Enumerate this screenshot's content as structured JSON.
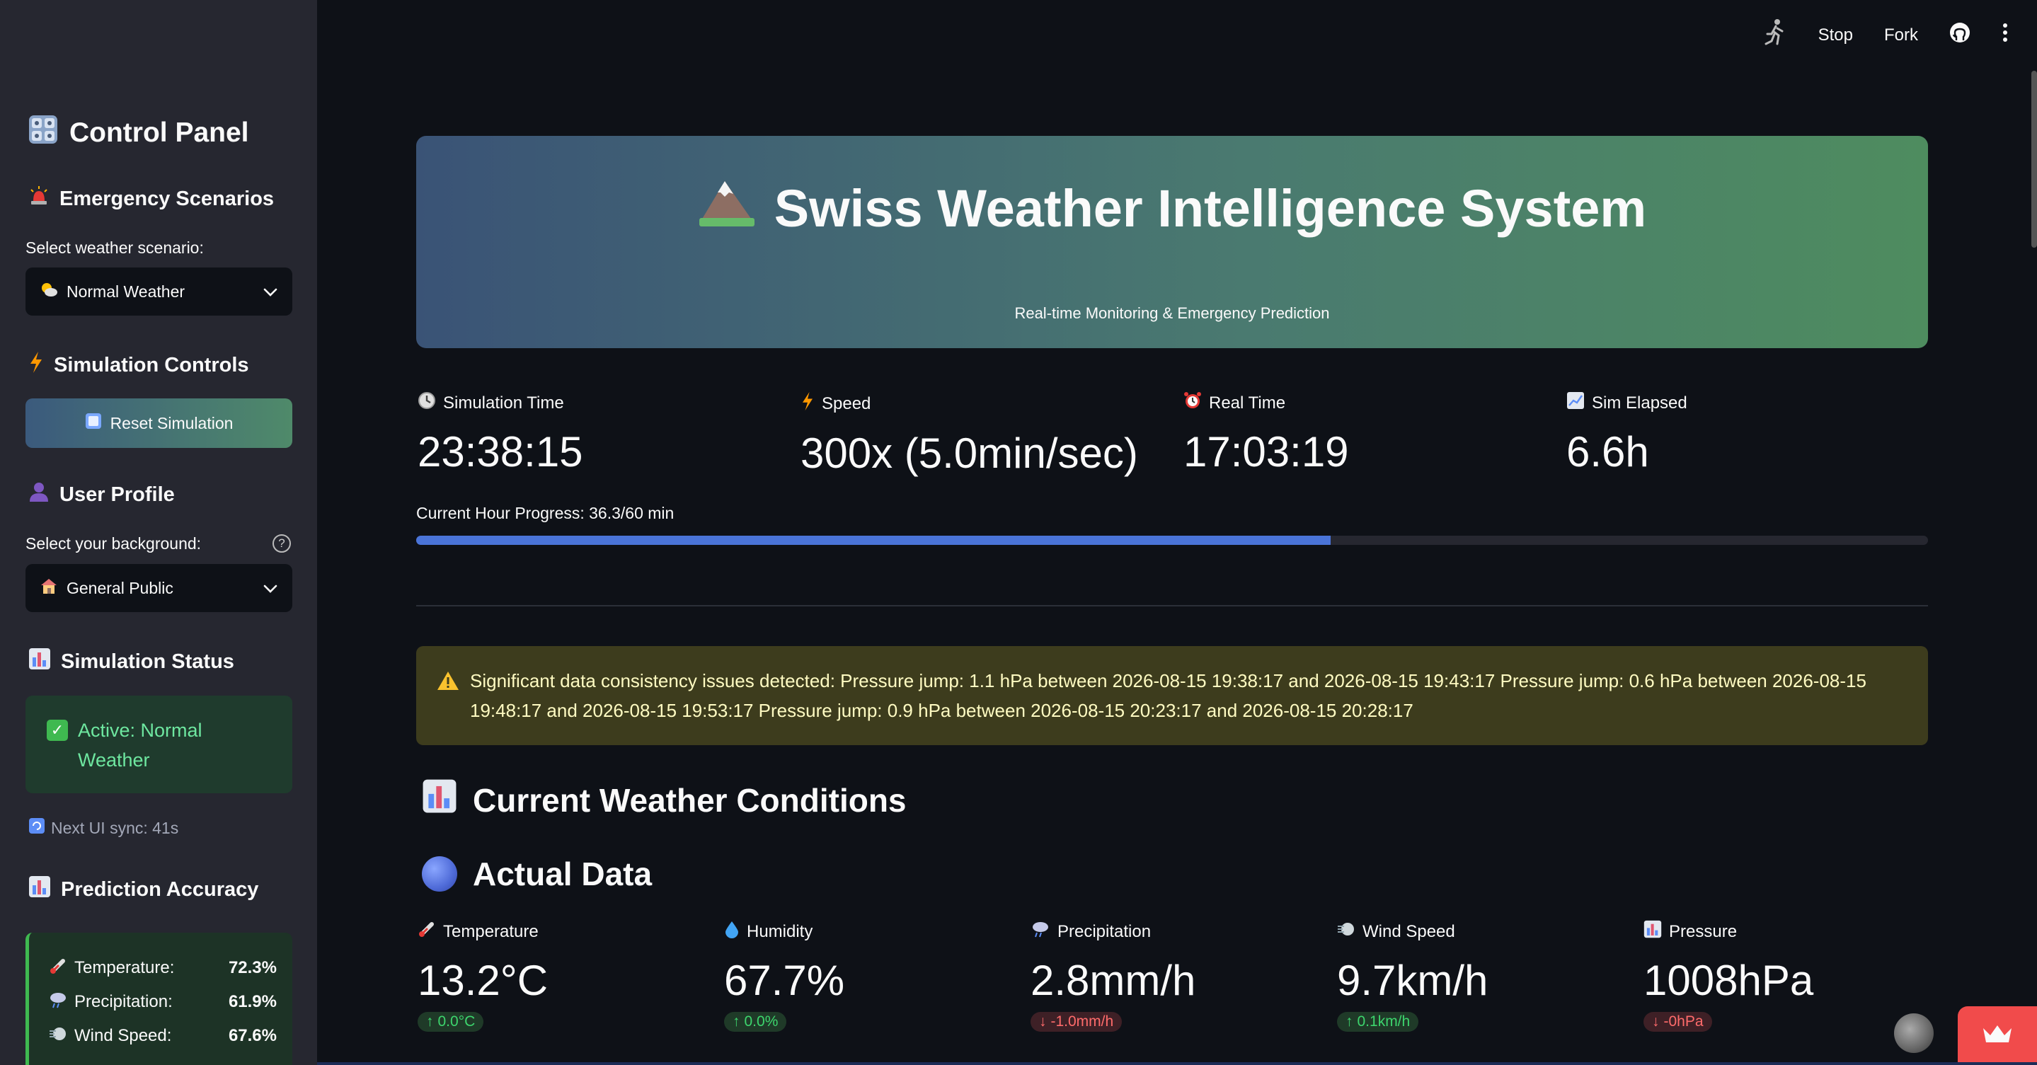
{
  "toolbar": {
    "stop_label": "Stop",
    "fork_label": "Fork"
  },
  "sidebar": {
    "title": "Control Panel",
    "emergency": {
      "heading": "Emergency Scenarios",
      "select_label": "Select weather scenario:",
      "selected": "Normal Weather"
    },
    "simulation": {
      "heading": "Simulation Controls",
      "reset_label": "Reset Simulation"
    },
    "user_profile": {
      "heading": "User Profile",
      "select_label": "Select your background:",
      "selected": "General Public"
    },
    "status": {
      "heading": "Simulation Status",
      "active_text": "Active: Normal Weather",
      "sync_text": "Next UI sync: 41s"
    },
    "accuracy": {
      "heading": "Prediction Accuracy",
      "rows": [
        {
          "name": "Temperature:",
          "value": "72.3%"
        },
        {
          "name": "Precipitation:",
          "value": "61.9%"
        },
        {
          "name": "Wind Speed:",
          "value": "67.6%"
        }
      ]
    }
  },
  "hero": {
    "title": "Swiss Weather Intelligence System",
    "subtitle": "Real-time Monitoring & Emergency Prediction"
  },
  "metrics": {
    "sim_time": {
      "label": "Simulation Time",
      "value": "23:38:15"
    },
    "speed": {
      "label": "Speed",
      "value": "300x (5.0min/sec)"
    },
    "real_time": {
      "label": "Real Time",
      "value": "17:03:19"
    },
    "sim_elapsed": {
      "label": "Sim Elapsed",
      "value": "6.6h"
    }
  },
  "progress": {
    "label": "Current Hour Progress: 36.3/60 min",
    "fraction": 0.605
  },
  "warning": {
    "text": "Significant data consistency issues detected: Pressure jump: 1.1 hPa between 2026-08-15 19:38:17 and 2026-08-15 19:43:17 Pressure jump: 0.6 hPa between 2026-08-15 19:48:17 and 2026-08-15 19:53:17 Pressure jump: 0.9 hPa between 2026-08-15 20:23:17 and 2026-08-15 20:28:17"
  },
  "conditions": {
    "heading": "Current Weather Conditions",
    "subheading": "Actual Data",
    "items": [
      {
        "label": "Temperature",
        "value": "13.2°C",
        "delta": "0.0°C",
        "direction": "up"
      },
      {
        "label": "Humidity",
        "value": "67.7%",
        "delta": "0.0%",
        "direction": "up"
      },
      {
        "label": "Precipitation",
        "value": "2.8mm/h",
        "delta": "-1.0mm/h",
        "direction": "down"
      },
      {
        "label": "Wind Speed",
        "value": "9.7km/h",
        "delta": "0.1km/h",
        "direction": "up"
      },
      {
        "label": "Pressure",
        "value": "1008hPa",
        "delta": "-0hPa",
        "direction": "down"
      }
    ]
  },
  "colors": {
    "accent": "#4a74d8",
    "success": "#3dd56d",
    "danger": "#ff6b6b"
  }
}
